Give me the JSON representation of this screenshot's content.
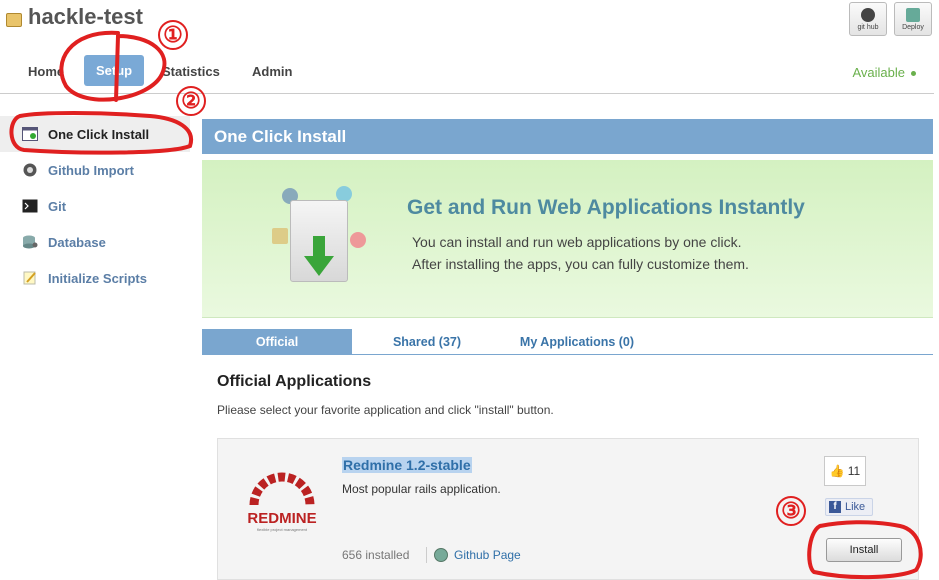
{
  "header": {
    "app_title": "hackle-test",
    "github_label": "git hub",
    "deploy_label": "Deploy"
  },
  "nav": {
    "items": [
      "Home",
      "Setup",
      "Statistics",
      "Admin"
    ],
    "status": "Available"
  },
  "sidebar": {
    "items": [
      {
        "label": "One Click Install",
        "icon": "install-icon"
      },
      {
        "label": "Github Import",
        "icon": "github-icon"
      },
      {
        "label": "Git",
        "icon": "terminal-icon"
      },
      {
        "label": "Database",
        "icon": "database-icon"
      },
      {
        "label": "Initialize Scripts",
        "icon": "script-icon"
      }
    ]
  },
  "main": {
    "panel_title": "One Click Install",
    "banner": {
      "headline": "Get and Run Web Applications Instantly",
      "line1": "You can install and run web applications by one click.",
      "line2": "After installing the apps, you can fully customize them."
    },
    "tabs": [
      "Official",
      "Shared (37)",
      "My Applications (0)"
    ],
    "section_title": "Official Applications",
    "section_desc": "Pliease select your favorite application and click \"install\" button.",
    "app": {
      "name": "Redmine 1.2-stable",
      "description": "Most popular rails application.",
      "installed": "656 installed",
      "github_link": "Github Page",
      "like_count": "11",
      "like_label": "Like",
      "install_label": "Install",
      "logo_text": "REDMINE",
      "logo_tagline": "flexible project management"
    }
  },
  "annotations": {
    "n1": "①",
    "n2": "②",
    "n3": "③"
  },
  "colors": {
    "accent": "#7aa6cf",
    "annotation": "#e02020",
    "status": "#6ab04c"
  }
}
